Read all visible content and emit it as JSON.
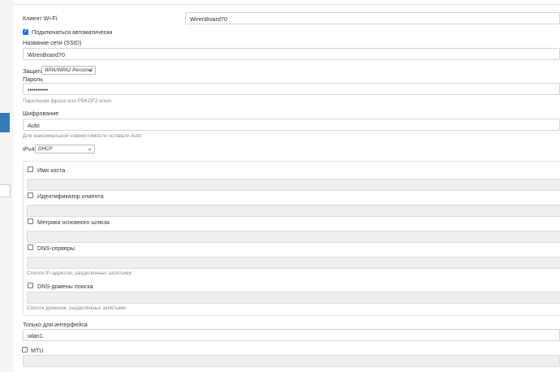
{
  "wifi": {
    "title": "Клиент Wi-Fi",
    "name_value": "WirenBoard70",
    "autoconnect_label": "Подключаться автоматически",
    "autoconnect_checked": true,
    "ssid_label": "Название сети (SSID)",
    "ssid_value": "WirenBoard70",
    "security_label": "Защита",
    "security_value": "WPA/WPA2 Personal",
    "password_label": "Пароль",
    "password_value": "••••••••••",
    "password_hint": "Парольная фраза или PBKDF2-ключ",
    "cipher_label": "Шифрование",
    "cipher_value": "Auto",
    "cipher_hint": "Для максимальной совместимости оставьте Auto",
    "ipv4_label": "IPv4",
    "ipv4_value": "DHCP"
  },
  "dhcp": {
    "hostname_label": "Имя хоста",
    "client_id_label": "Идентификатор клиента",
    "metric_label": "Метрика основного шлюза",
    "dns_label": "DNS-серверы",
    "dns_hint": "Список IP-адресов, разделённых запятыми",
    "search_label": "DNS-домены поиска",
    "search_hint": "Список доменов, разделённых запятыми"
  },
  "iface": {
    "label": "Только для интерфейса",
    "value": "wlan1"
  },
  "mtu": {
    "label": "MTU"
  },
  "colors": {
    "accent": "#337ab7",
    "checkbox": "#1a73e8",
    "disabled_field": "#eeeeee"
  },
  "icons": {
    "check": "✓",
    "chevron": "⌄"
  }
}
